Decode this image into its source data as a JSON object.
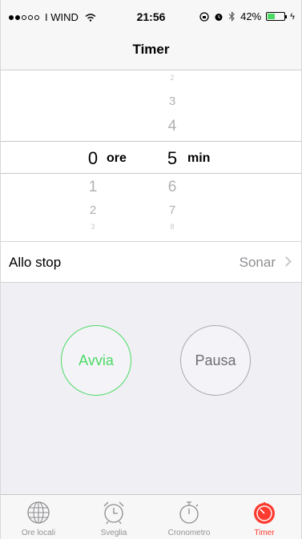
{
  "status_bar": {
    "carrier": "I WIND",
    "time": "21:56",
    "battery": "42%",
    "battery_level": 0.42
  },
  "nav": {
    "title": "Timer"
  },
  "picker": {
    "hours_above": [],
    "hours_selected": "0",
    "hours_unit": "ore",
    "hours_below": [
      "1",
      "2",
      "3"
    ],
    "minutes_above": [
      "2",
      "3",
      "4"
    ],
    "minutes_selected": "5",
    "minutes_unit": "min",
    "minutes_below": [
      "6",
      "7",
      "8"
    ]
  },
  "sound_row": {
    "label": "Allo stop",
    "value": "Sonar"
  },
  "buttons": {
    "start": "Avvia",
    "pause": "Pausa"
  },
  "colors": {
    "accent_green": "#4cd964",
    "accent_red": "#ff3b30"
  },
  "tabs": [
    {
      "label": "Ore locali",
      "icon": "globe-icon"
    },
    {
      "label": "Sveglia",
      "icon": "alarm-clock-icon"
    },
    {
      "label": "Cronometro",
      "icon": "stopwatch-icon"
    },
    {
      "label": "Timer",
      "icon": "timer-icon",
      "active": true
    }
  ]
}
